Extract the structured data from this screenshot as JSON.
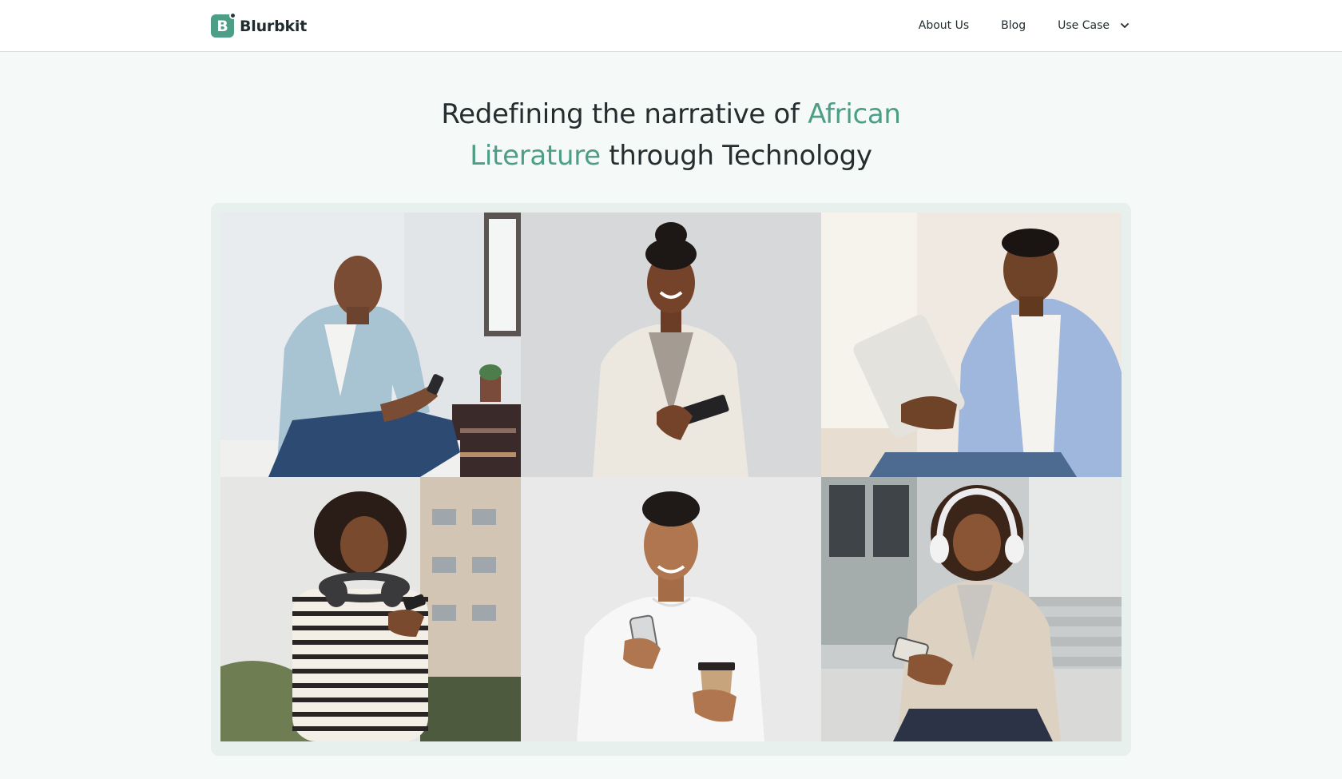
{
  "header": {
    "logo": {
      "mark_letter": "B",
      "text": "Blurbkit",
      "icon": "blurbkit-logo-icon"
    },
    "nav": {
      "about_label": "About Us",
      "blog_label": "Blog",
      "use_case_label": "Use Case",
      "use_case_icon": "chevron-down-icon"
    }
  },
  "hero": {
    "title_part1": "Redefining the narrative of ",
    "title_accent1": "African",
    "title_accent2": "Literature",
    "title_part2": " through Technology"
  },
  "gallery": {
    "photos": [
      {
        "name": "man-on-phone-sofa-photo",
        "bg": "#dfe3e6"
      },
      {
        "name": "woman-with-tablet-photo",
        "bg": "#d6d7d9"
      },
      {
        "name": "man-with-tablet-photo",
        "bg": "#ece6dd"
      },
      {
        "name": "woman-with-headphones-phone-photo",
        "bg": "#cfd2d0"
      },
      {
        "name": "man-phone-coffee-photo",
        "bg": "#e7e7e8"
      },
      {
        "name": "woman-headphones-stairs-photo",
        "bg": "#c9cccc"
      }
    ]
  },
  "colors": {
    "accent": "#4d9e86",
    "text": "#252d2f",
    "page_bg": "#f5f9f8",
    "frame_bg": "#e7f0ed"
  }
}
